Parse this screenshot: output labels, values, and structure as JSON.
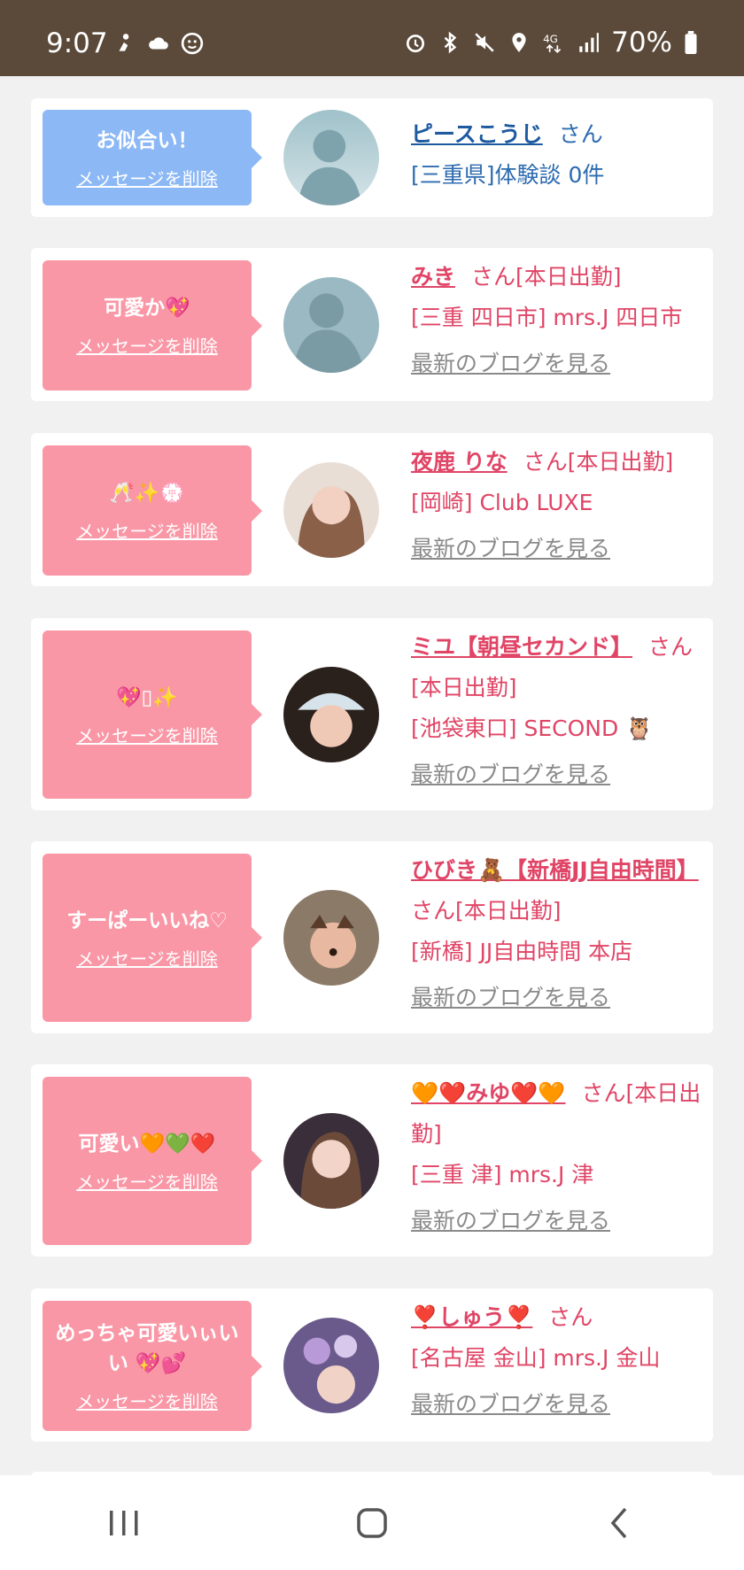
{
  "status_bar": {
    "time": "9:07",
    "left_icons": [
      "activity-icon",
      "cloud-icon",
      "face-icon"
    ],
    "right_icons": [
      "alarm-icon",
      "bluetooth-icon",
      "mute-icon",
      "location-icon",
      "4g-icon",
      "signal-icon"
    ],
    "battery": "70%"
  },
  "delete_label": "メッセージを削除",
  "blog_label": "最新のブログを見る",
  "cards": [
    {
      "message": "お似合い！",
      "name": "ピースこうじ",
      "suffix": "さん",
      "line2": "[三重県]体験談 0件",
      "line3": ""
    },
    {
      "message": "可愛か💖",
      "name": "みき",
      "suffix": "さん[本日出勤]",
      "line2": "[三重 四日市] mrs.J 四日市",
      "line3": ""
    },
    {
      "message": "🥂✨💮",
      "name": "夜鹿 りな",
      "suffix": "さん[本日出勤]",
      "line2": "[岡崎] Club LUXE",
      "line3": ""
    },
    {
      "message": "💖▯✨",
      "name": "ミユ【朝昼セカンド】",
      "suffix": "さん[本日出勤]",
      "line2": "[池袋東口] SECOND 🦉",
      "line3": ""
    },
    {
      "message": "すーぱーいいね♡",
      "name": "ひびき🧸【新橋JJ自由時間】",
      "suffix": "さん[本日出勤]",
      "line2": "[新橋] JJ自由時間 本店",
      "line3": ""
    },
    {
      "message": "可愛い🧡💚❤️",
      "name": "🧡❤️みゆ❤️🧡",
      "suffix": "さん[本日出勤]",
      "line2": "[三重 津] mrs.J 津",
      "line3": ""
    },
    {
      "message": "めっちゃ可愛いぃいい 💖💕",
      "name": "❣️しゅう❣️",
      "suffix": "さん",
      "line2": "[名古屋 金山] mrs.J 金山",
      "line3": ""
    }
  ],
  "nav": [
    "recents-button",
    "home-button",
    "back-button"
  ]
}
